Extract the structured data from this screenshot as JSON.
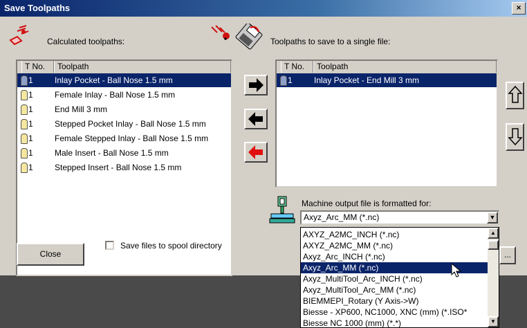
{
  "window": {
    "title": "Save Toolpaths",
    "close_glyph": "×"
  },
  "left_panel": {
    "label": "Calculated toolpaths:",
    "columns": [
      "T No.",
      "Toolpath"
    ],
    "rows": [
      {
        "no": "1",
        "name": "Inlay Pocket - Ball Nose 1.5 mm",
        "selected": true
      },
      {
        "no": "1",
        "name": "Female Inlay - Ball Nose 1.5 mm"
      },
      {
        "no": "1",
        "name": "End Mill 3 mm"
      },
      {
        "no": "1",
        "name": "Stepped Pocket Inlay - Ball Nose 1.5 mm"
      },
      {
        "no": "1",
        "name": "Female Stepped Inlay - Ball Nose 1.5 mm"
      },
      {
        "no": "1",
        "name": "Male Insert - Ball Nose 1.5 mm"
      },
      {
        "no": "1",
        "name": "Stepped Insert - Ball Nose 1.5 mm"
      }
    ]
  },
  "right_panel": {
    "label": "Toolpaths to save to a single file:",
    "columns": [
      "T No.",
      "Toolpath"
    ],
    "rows": [
      {
        "no": "1",
        "name": "Inlay Pocket - End Mill 3 mm",
        "selected": true
      }
    ]
  },
  "machine": {
    "label": "Machine output file is formatted for:",
    "selected": "Axyz_Arc_MM (*.nc)",
    "options": [
      "AXYZ_A2MC_INCH (*.nc)",
      "AXYZ_A2MC_MM (*.nc)",
      "Axyz_Arc_INCH (*.nc)",
      "Axyz_Arc_MM (*.nc)",
      "Axyz_MultiTool_Arc_INCH (*.nc)",
      "Axyz_MultiTool_Arc_MM (*.nc)",
      "BIEMMEPI_Rotary (Y Axis->W)",
      "Biesse - XP600, NC1000, XNC (mm) (*.ISO*",
      "Biesse NC 1000 (mm) (*.*)"
    ]
  },
  "buttons": {
    "close": "Close",
    "browse": "..."
  },
  "spool_checkbox": {
    "label": "Save files to spool directory",
    "checked": false
  }
}
